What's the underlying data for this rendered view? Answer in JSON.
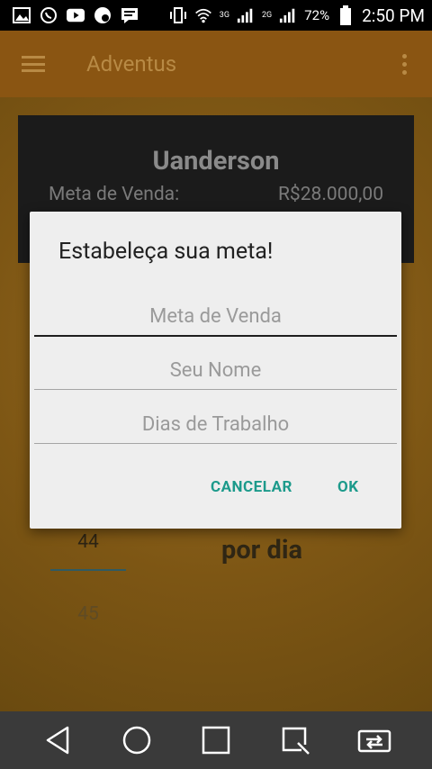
{
  "status_bar": {
    "battery_percent": "72%",
    "time": "2:50 PM",
    "network_3g": "3G",
    "network_2g": "2G",
    "icons": [
      "gallery-icon",
      "whatsapp-icon",
      "youtube-icon",
      "notification-icon",
      "message-icon",
      "vibrate-icon",
      "wifi-icon",
      "signal-icon",
      "battery-icon"
    ]
  },
  "app_bar": {
    "title": "Adventus",
    "menu_icon": "hamburger-menu-icon",
    "overflow_icon": "more-vert-icon"
  },
  "card": {
    "name": "Uanderson",
    "label": "Meta de Venda:",
    "value": "R$28.000,00"
  },
  "picker": {
    "selected": "44",
    "next": "45"
  },
  "per_day_label": "por dia",
  "dialog": {
    "title": "Estabeleça sua meta!",
    "fields": [
      {
        "placeholder": "Meta de Venda",
        "value": ""
      },
      {
        "placeholder": "Seu Nome",
        "value": ""
      },
      {
        "placeholder": "Dias de Trabalho",
        "value": ""
      }
    ],
    "cancel_label": "CANCELAR",
    "ok_label": "OK"
  },
  "colors": {
    "accent": "#1c9a8b",
    "app_bar": "#8a5512",
    "dialog_bg": "#eeeeee"
  },
  "nav_bar": {
    "buttons": [
      "back-icon",
      "home-icon",
      "recents-icon",
      "qslide-icon",
      "dual-window-icon"
    ]
  }
}
